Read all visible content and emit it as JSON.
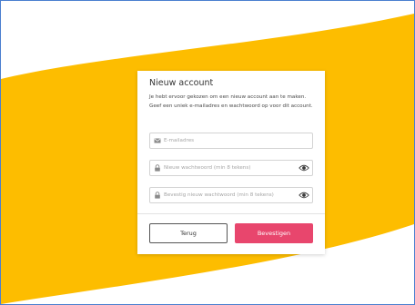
{
  "dialog": {
    "title": "Nieuw account",
    "description": "Je hebt ervoor gekozen om een nieuw account aan te maken. Geef een uniek e-mailadres en wachtwoord op voor dit account."
  },
  "form": {
    "email": {
      "placeholder": "E-mailadres",
      "icon": "envelope-icon"
    },
    "new_password": {
      "placeholder": "Nieuw wachtwoord (min 8 tekens)",
      "icon": "lock-icon",
      "toggle_icon": "eye-icon"
    },
    "confirm_password": {
      "placeholder": "Bevestig nieuw wachtwoord (min 8 tekens)",
      "icon": "lock-icon",
      "toggle_icon": "eye-icon"
    }
  },
  "actions": {
    "back_label": "Terug",
    "confirm_label": "Bevestigen"
  },
  "colors": {
    "background_wave": "#fdbd00",
    "confirm_button": "#e8466d",
    "frame_border": "#4a7fd0"
  }
}
